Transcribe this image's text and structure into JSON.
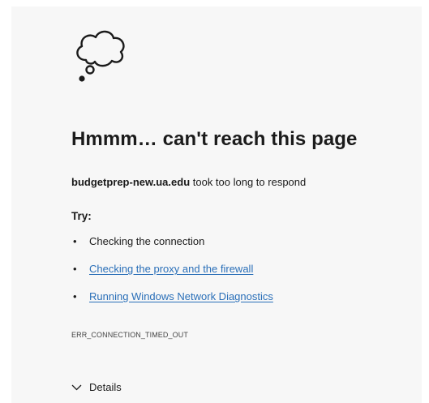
{
  "error": {
    "title": "Hmmm… can't reach this page",
    "host": "budgetprep-new.ua.edu",
    "reason_suffix": " took too long to respond",
    "try_label": "Try:",
    "suggestions": [
      {
        "label": "Checking the connection",
        "is_link": false
      },
      {
        "label": "Checking the proxy and the firewall",
        "is_link": true
      },
      {
        "label": "Running Windows Network Diagnostics",
        "is_link": true
      }
    ],
    "code": "ERR_CONNECTION_TIMED_OUT",
    "details_label": "Details"
  },
  "colors": {
    "page_background": "#f7f7f7",
    "link": "#2a6fb8",
    "text": "#1b1b1b"
  },
  "icons": {
    "cloud": "thought-cloud-icon",
    "details": "chevron-down-icon"
  }
}
